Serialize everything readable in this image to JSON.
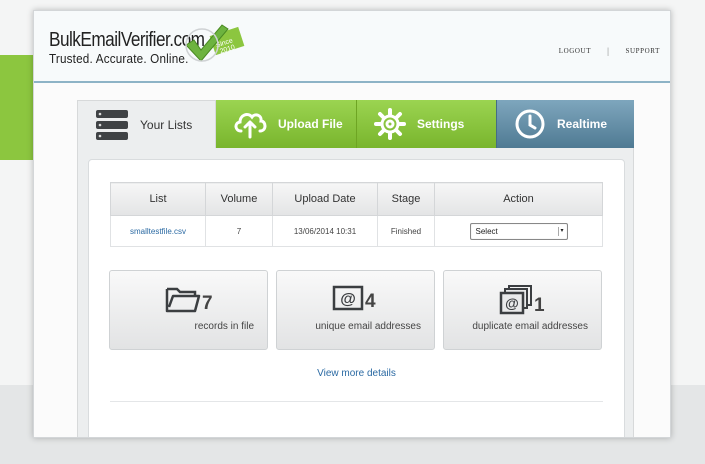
{
  "brand": {
    "name": "BulkEmailVerifier.com",
    "tagline": "Trusted. Accurate. Online.",
    "badge_line1": "Since",
    "badge_line2": "2010"
  },
  "nav": {
    "logout": "LOGOUT",
    "separator": "|",
    "support": "SUPPORT"
  },
  "tabs": [
    {
      "label": "Your Lists",
      "icon": "server-stack-icon",
      "active": true
    },
    {
      "label": "Upload File",
      "icon": "cloud-upload-icon",
      "active": false
    },
    {
      "label": "Settings",
      "icon": "gear-icon",
      "active": false
    },
    {
      "label": "Realtime",
      "icon": "clock-icon",
      "active": false
    }
  ],
  "table": {
    "headers": [
      "List",
      "Volume",
      "Upload Date",
      "Stage",
      "Action"
    ],
    "rows": [
      {
        "list": "smalltestfile.csv",
        "volume": "7",
        "upload_date": "13/06/2014 10:31",
        "stage": "Finished",
        "action": "Select"
      }
    ]
  },
  "stats": [
    {
      "number": "7",
      "label": "records in file",
      "icon": "folder-icon"
    },
    {
      "number": "4",
      "label": "unique email addresses",
      "icon": "at-sign-icon"
    },
    {
      "number": "1",
      "label": "duplicate email addresses",
      "icon": "duplicate-at-sign-icon"
    }
  ],
  "more_link": "View more details",
  "colors": {
    "green": "#8cc63f",
    "blue_tab": "#5f8aa3",
    "link": "#2b6aa3"
  }
}
